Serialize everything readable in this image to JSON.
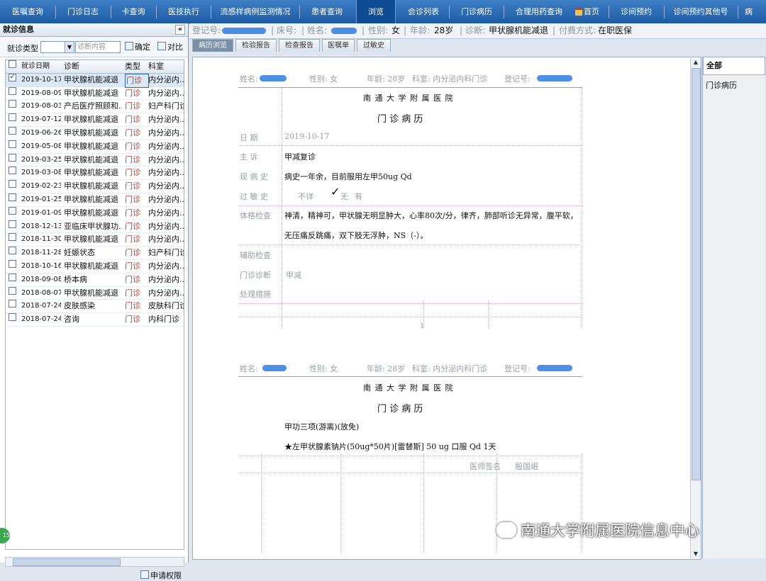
{
  "topnav": {
    "items": [
      "医嘱查询",
      "门诊日志",
      "卡查询",
      "医技执行",
      "流感样病例监测情况",
      "患者查询",
      "浏览",
      "会诊列表",
      "门诊病历",
      "合理用药查询",
      "首页",
      "诊间预约",
      "诊间预约其他号",
      "病"
    ],
    "active_index": 6
  },
  "left": {
    "title": "就诊信息",
    "collapse": "«",
    "filter_label": "就诊类型",
    "search_placeholder": "诊断内容",
    "confirm_label": "确定",
    "compare_label": "对比",
    "headers": [
      "就诊日期",
      "诊断",
      "类型",
      "科室"
    ],
    "rows": [
      {
        "date": "2019-10-17",
        "diag": "甲状腺机能减退",
        "type": "门诊",
        "dept": "内分泌内...",
        "checked": true
      },
      {
        "date": "2019-08-09",
        "diag": "甲状腺机能减退",
        "type": "门诊",
        "dept": "内分泌内..."
      },
      {
        "date": "2019-08-03",
        "diag": "产后医疗照顾和...",
        "type": "门诊",
        "dept": "妇产科门诊"
      },
      {
        "date": "2019-07-12",
        "diag": "甲状腺机能减退",
        "type": "门诊",
        "dept": "内分泌内..."
      },
      {
        "date": "2019-06-26",
        "diag": "甲状腺机能减退",
        "type": "门诊",
        "dept": "内分泌内..."
      },
      {
        "date": "2019-05-08",
        "diag": "甲状腺机能减退",
        "type": "门诊",
        "dept": "内分泌内..."
      },
      {
        "date": "2019-03-25",
        "diag": "甲状腺机能减退",
        "type": "门诊",
        "dept": "内分泌内..."
      },
      {
        "date": "2019-03-08",
        "diag": "甲状腺机能减退",
        "type": "门诊",
        "dept": "内分泌内..."
      },
      {
        "date": "2019-02-23",
        "diag": "甲状腺机能减退",
        "type": "门诊",
        "dept": "内分泌内..."
      },
      {
        "date": "2019-01-25",
        "diag": "甲状腺机能减退",
        "type": "门诊",
        "dept": "内分泌内..."
      },
      {
        "date": "2019-01-09",
        "diag": "甲状腺机能减退",
        "type": "门诊",
        "dept": "内分泌内..."
      },
      {
        "date": "2018-12-13",
        "diag": "亚临床甲状腺功...",
        "type": "门诊",
        "dept": "内分泌内..."
      },
      {
        "date": "2018-11-30",
        "diag": "甲状腺机能减退",
        "type": "门诊",
        "dept": "内分泌内..."
      },
      {
        "date": "2018-11-28",
        "diag": "妊娠状态",
        "type": "门诊",
        "dept": "妇产科门诊"
      },
      {
        "date": "2018-10-16",
        "diag": "甲状腺机能减退",
        "type": "门诊",
        "dept": "内分泌内..."
      },
      {
        "date": "2018-09-08",
        "diag": "桥本病",
        "type": "门诊",
        "dept": "内分泌内..."
      },
      {
        "date": "2018-08-07",
        "diag": "甲状腺机能减退",
        "type": "门诊",
        "dept": "内分泌内..."
      },
      {
        "date": "2018-07-24",
        "diag": "皮肤感染",
        "type": "门诊",
        "dept": "皮肤科门诊"
      },
      {
        "date": "2018-07-24",
        "diag": "咨询",
        "type": "门诊",
        "dept": "内科门诊"
      }
    ],
    "permission_label": "申请权限"
  },
  "patient": {
    "reg_label": "登记号:",
    "bed_label": "床号:",
    "name_label": "姓名:",
    "sex_label": "性别:",
    "sex": "女",
    "age_label": "年龄:",
    "age": "28岁",
    "diag_label": "诊断:",
    "diag": "甲状腺机能减退",
    "pay_label": "付费方式:",
    "pay": "在职医保"
  },
  "tabs": [
    "病历浏览",
    "检验报告",
    "检查报告",
    "医嘱单",
    "过敏史"
  ],
  "doc1": {
    "header_name": "姓名:",
    "header_sex": "性别: 女",
    "header_age": "年龄: 28岁",
    "header_dept": "科室: 内分泌内科门诊",
    "header_reg": "登记号:",
    "hospital": "南 通 大 学 附 属 医 院",
    "title": "门  诊  病  历",
    "date_label": "日    期",
    "date": "2019-10-17",
    "cc_label": "主    诉",
    "cc": "甲减复诊",
    "hpi_label": "现 病 史",
    "hpi": "病史一年余，目前服用左甲50ug Qd",
    "allergy_label": "过 敏 史",
    "allergy_a": "不详",
    "allergy_b": "无",
    "allergy_c": "有",
    "exam_label": "体格检查",
    "exam1": "神清，精神可，甲状腺无明显肿大，心率80次/分，律齐，肺部听诊无异常，腹平软，",
    "exam2": "无压痛反跳痛，双下肢无浮肿，NS（-）。",
    "aux_label": "辅助检查",
    "dx_label": "门诊诊断",
    "dx": "甲减",
    "plan_label": "处理措施",
    "page": "1"
  },
  "doc2": {
    "header_name": "姓名:",
    "header_sex": "性别: 女",
    "header_age": "年龄: 28岁",
    "header_dept": "科室: 内分泌内科门诊",
    "header_reg": "登记号:",
    "hospital": "南 通 大 学 附 属 医 院",
    "title": "门  诊  病  历",
    "line1": "甲功三项(游离)(放免)",
    "line2": "★左甲状腺素钠片(50ug*50片)[雷替斯] 50 ug 口服 Qd 1天",
    "sign_label": "医师签名",
    "sign": "殷国岷"
  },
  "right": {
    "items": [
      "全部",
      "门诊病历"
    ]
  },
  "watermark": "南通大学附属医院信息中心",
  "badge": "15",
  "colors": {
    "nav": "#1d5aa5",
    "type_text": "#c0392b",
    "redact": "#2e7de1"
  }
}
